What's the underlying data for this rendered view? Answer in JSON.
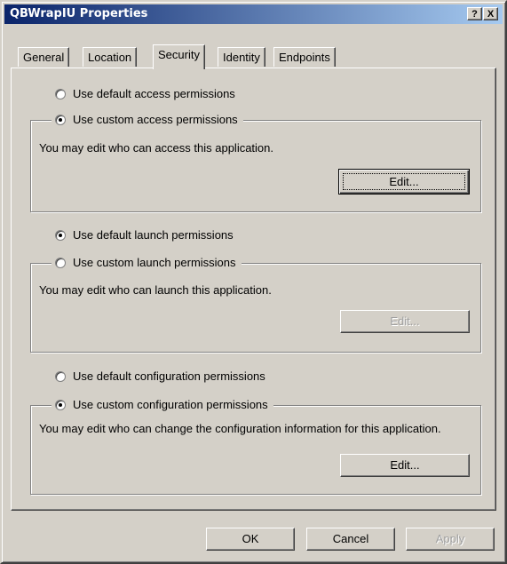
{
  "window": {
    "title": "QBWrapIU Properties"
  },
  "titlebar_buttons": {
    "help": "?",
    "close": "X"
  },
  "tabs": [
    "General",
    "Location",
    "Security",
    "Identity",
    "Endpoints"
  ],
  "active_tab": "Security",
  "access": {
    "default_label": "Use default access permissions",
    "custom_label": "Use custom access permissions",
    "selected": "custom",
    "description": "You may edit who can access this application.",
    "edit_label": "Edit...",
    "edit_enabled": true
  },
  "launch": {
    "default_label": "Use default launch permissions",
    "custom_label": "Use custom launch permissions",
    "selected": "default",
    "description": "You may edit who can launch this application.",
    "edit_label": "Edit...",
    "edit_enabled": false
  },
  "configuration": {
    "default_label": "Use default configuration permissions",
    "custom_label": "Use custom configuration permissions",
    "selected": "custom",
    "description": "You may edit who can change the configuration information for this application.",
    "edit_label": "Edit...",
    "edit_enabled": true
  },
  "footer": {
    "ok": "OK",
    "cancel": "Cancel",
    "apply": "Apply"
  },
  "colors": {
    "face": "#d4d0c8",
    "title_start": "#0a246a",
    "title_end": "#a6caf0"
  }
}
